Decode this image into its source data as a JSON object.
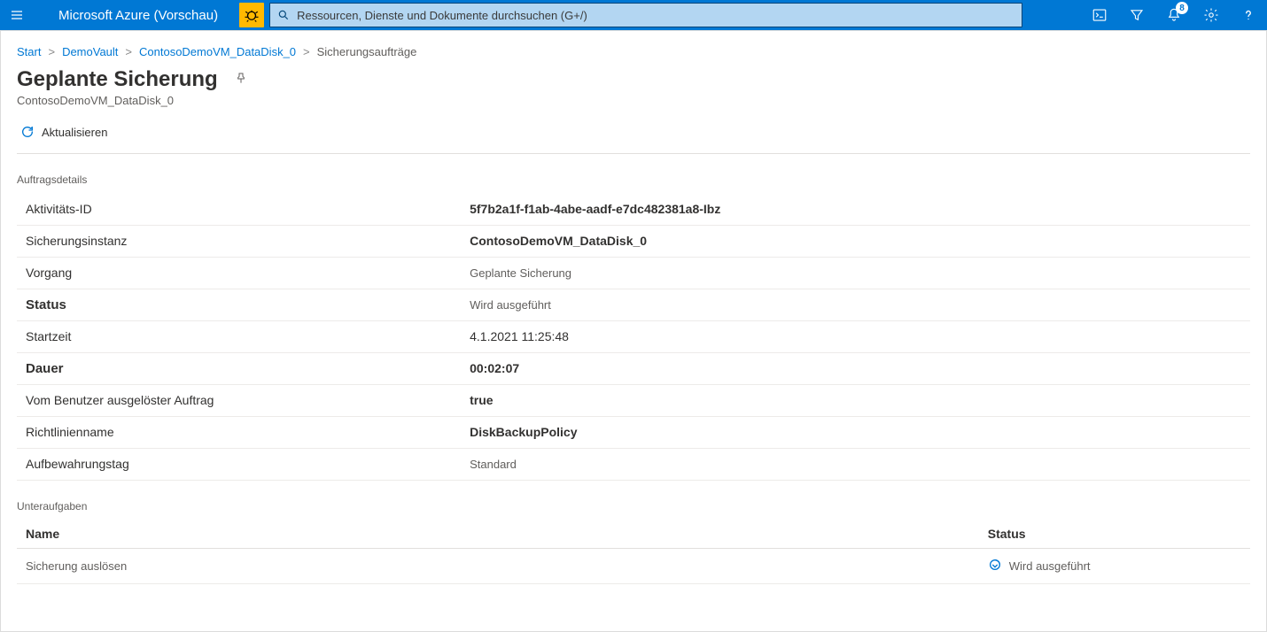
{
  "header": {
    "brand": "Microsoft Azure (Vorschau)",
    "search_placeholder": "Ressourcen, Dienste und Dokumente durchsuchen (G+/)",
    "notification_count": "8"
  },
  "breadcrumb": {
    "start": "Start",
    "items": [
      "DemoVault",
      "ContosoDemoVM_DataDisk_0"
    ],
    "current": "Sicherungsaufträge"
  },
  "page": {
    "title": "Geplante Sicherung",
    "subtitle": "ContosoDemoVM_DataDisk_0"
  },
  "toolbar": {
    "refresh_label": "Aktualisieren"
  },
  "details": {
    "section_label": "Auftragsdetails",
    "rows": [
      {
        "key": "Aktivitäts-ID",
        "value": "5f7b2a1f-f1ab-4abe-aadf-e7dc482381a8-Ibz",
        "key_bold": false,
        "val_bold": true
      },
      {
        "key": "Sicherungsinstanz",
        "value": "ContosoDemoVM_DataDisk_0",
        "key_bold": false,
        "val_bold": true
      },
      {
        "key": "Vorgang",
        "value": "Geplante Sicherung",
        "key_bold": false,
        "val_bold": false,
        "val_light": true
      },
      {
        "key": "Status",
        "value": "Wird ausgeführt",
        "key_bold": true,
        "val_bold": false,
        "val_light": true
      },
      {
        "key": "Startzeit",
        "value": "4.1.2021 11:25:48",
        "key_bold": false,
        "val_bold": false
      },
      {
        "key": "Dauer",
        "value": "00:02:07",
        "key_bold": true,
        "val_bold": true
      },
      {
        "key": "Vom Benutzer ausgelöster Auftrag",
        "value": "true",
        "key_bold": false,
        "val_bold": true
      },
      {
        "key": "Richtlinienname",
        "value": "DiskBackupPolicy",
        "key_bold": false,
        "val_bold": true
      },
      {
        "key": "Aufbewahrungstag",
        "value": "Standard",
        "key_bold": false,
        "val_bold": false,
        "val_light": true
      }
    ]
  },
  "subtasks": {
    "section_label": "Unteraufgaben",
    "columns": {
      "name": "Name",
      "status": "Status"
    },
    "rows": [
      {
        "name": "Sicherung auslösen",
        "status": "Wird ausgeführt"
      }
    ]
  }
}
